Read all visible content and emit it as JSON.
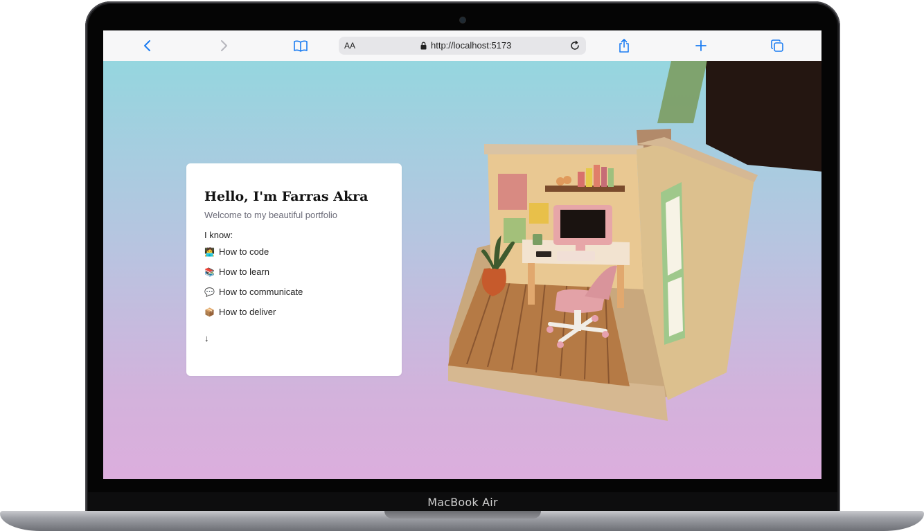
{
  "device": {
    "label": "MacBook Air"
  },
  "browser": {
    "url_prefix_text": "AA",
    "url": "http://localhost:5173",
    "icons": [
      "chevron-left-icon",
      "chevron-right-icon",
      "book-icon",
      "lock-icon",
      "reload-icon",
      "share-icon",
      "plus-icon",
      "tabs-icon"
    ]
  },
  "hero": {
    "title": "Hello, I'm Farras Akra",
    "subtitle": "Welcome to my beautiful portfolio",
    "intro": "I know:",
    "skills": [
      {
        "emoji": "🧑‍💻",
        "label": "How to code"
      },
      {
        "emoji": "📚",
        "label": "How to learn"
      },
      {
        "emoji": "💬",
        "label": "How to communicate"
      },
      {
        "emoji": "📦",
        "label": "How to deliver"
      }
    ],
    "scroll_hint": "↓"
  },
  "colors": {
    "gradient_top": "#95d6df",
    "gradient_bottom": "#dcaedd",
    "link_blue": "#1a7cf2"
  }
}
